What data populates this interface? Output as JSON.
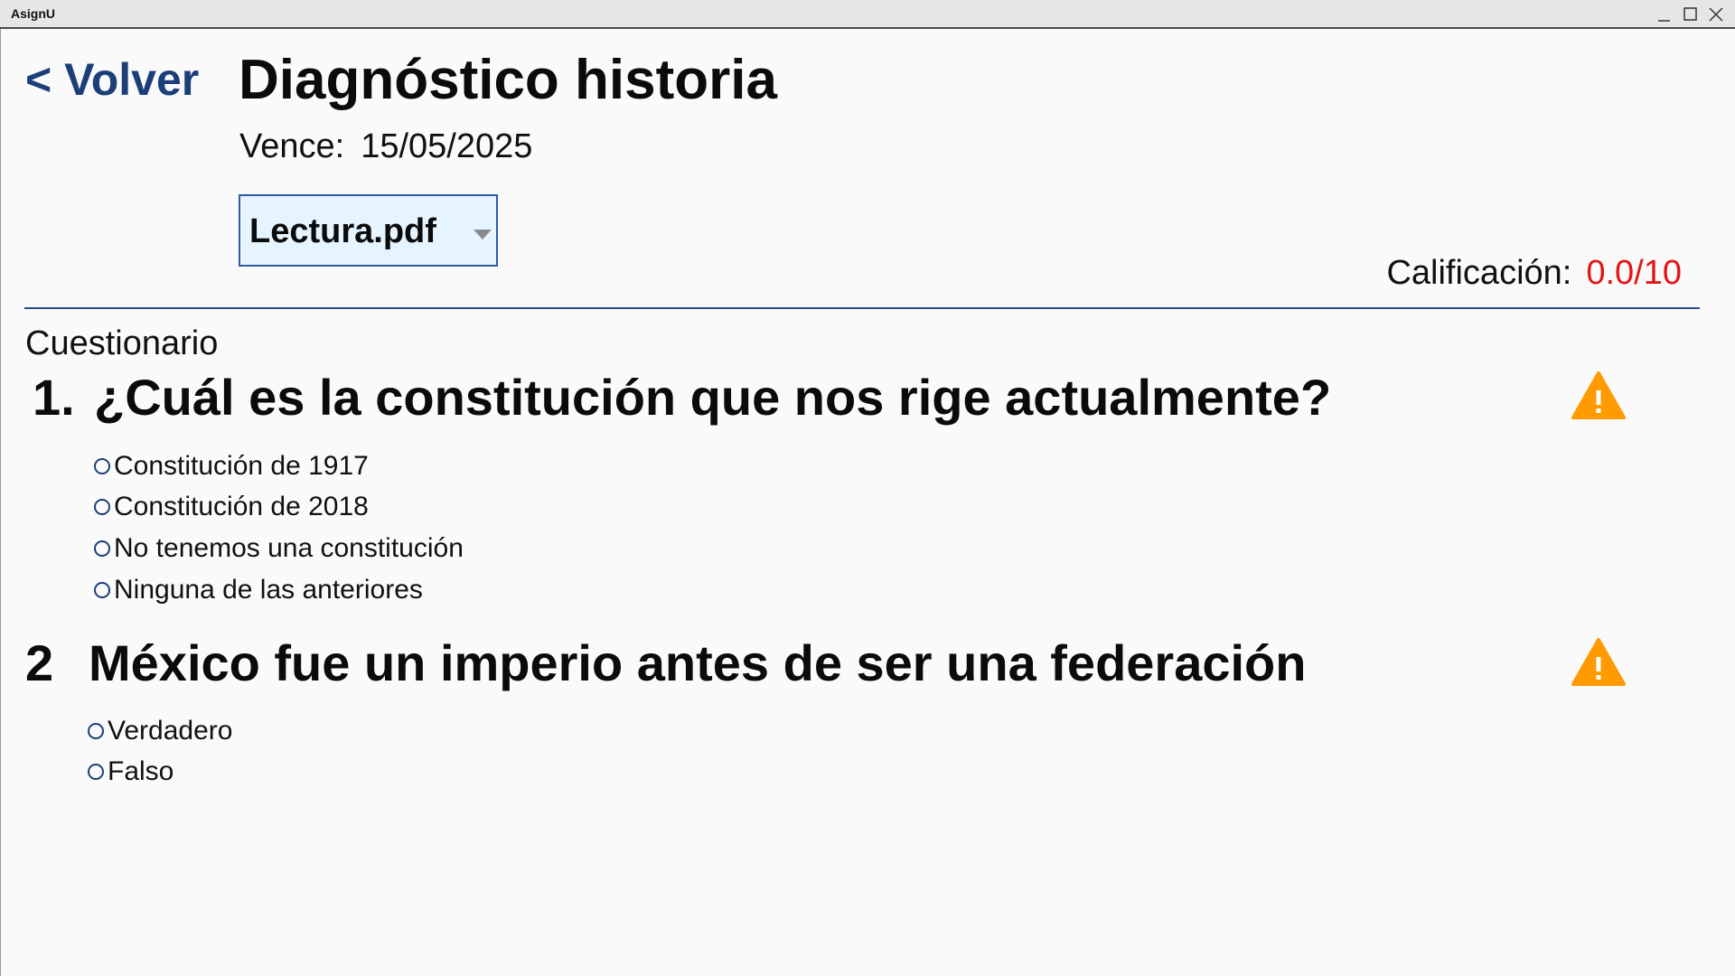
{
  "window": {
    "title": "AsignU",
    "controls": [
      "minimize-icon",
      "maximize-icon",
      "close-icon"
    ]
  },
  "header": {
    "back_label": "< Volver",
    "title": "Diagnóstico historia",
    "due_label": "Vence:",
    "due_date": "15/05/2025"
  },
  "attachment": {
    "selected": "Lectura.pdf",
    "icon": "chevron-down-icon"
  },
  "grade": {
    "label": "Calificación:",
    "value": "0.0/10",
    "value_color": "#e31616"
  },
  "colors": {
    "accent": "#1c3f7a",
    "divider": "#2c4a8a",
    "select_bg": "#e5f4ff",
    "warning": "#ff9a00"
  },
  "quiz": {
    "section_label": "Cuestionario",
    "questions": [
      {
        "number": "1.",
        "text": "¿Cuál es la constitución que nos rige actualmente?",
        "status_icon": "warning-icon",
        "options": [
          "Constitución de 1917",
          "Constitución de 2018",
          "No tenemos una constitución",
          "Ninguna de las anteriores"
        ]
      },
      {
        "number": "2",
        "text": "México fue un imperio antes de ser una federación",
        "status_icon": "warning-icon",
        "options": [
          "Verdadero",
          "Falso"
        ]
      }
    ]
  }
}
